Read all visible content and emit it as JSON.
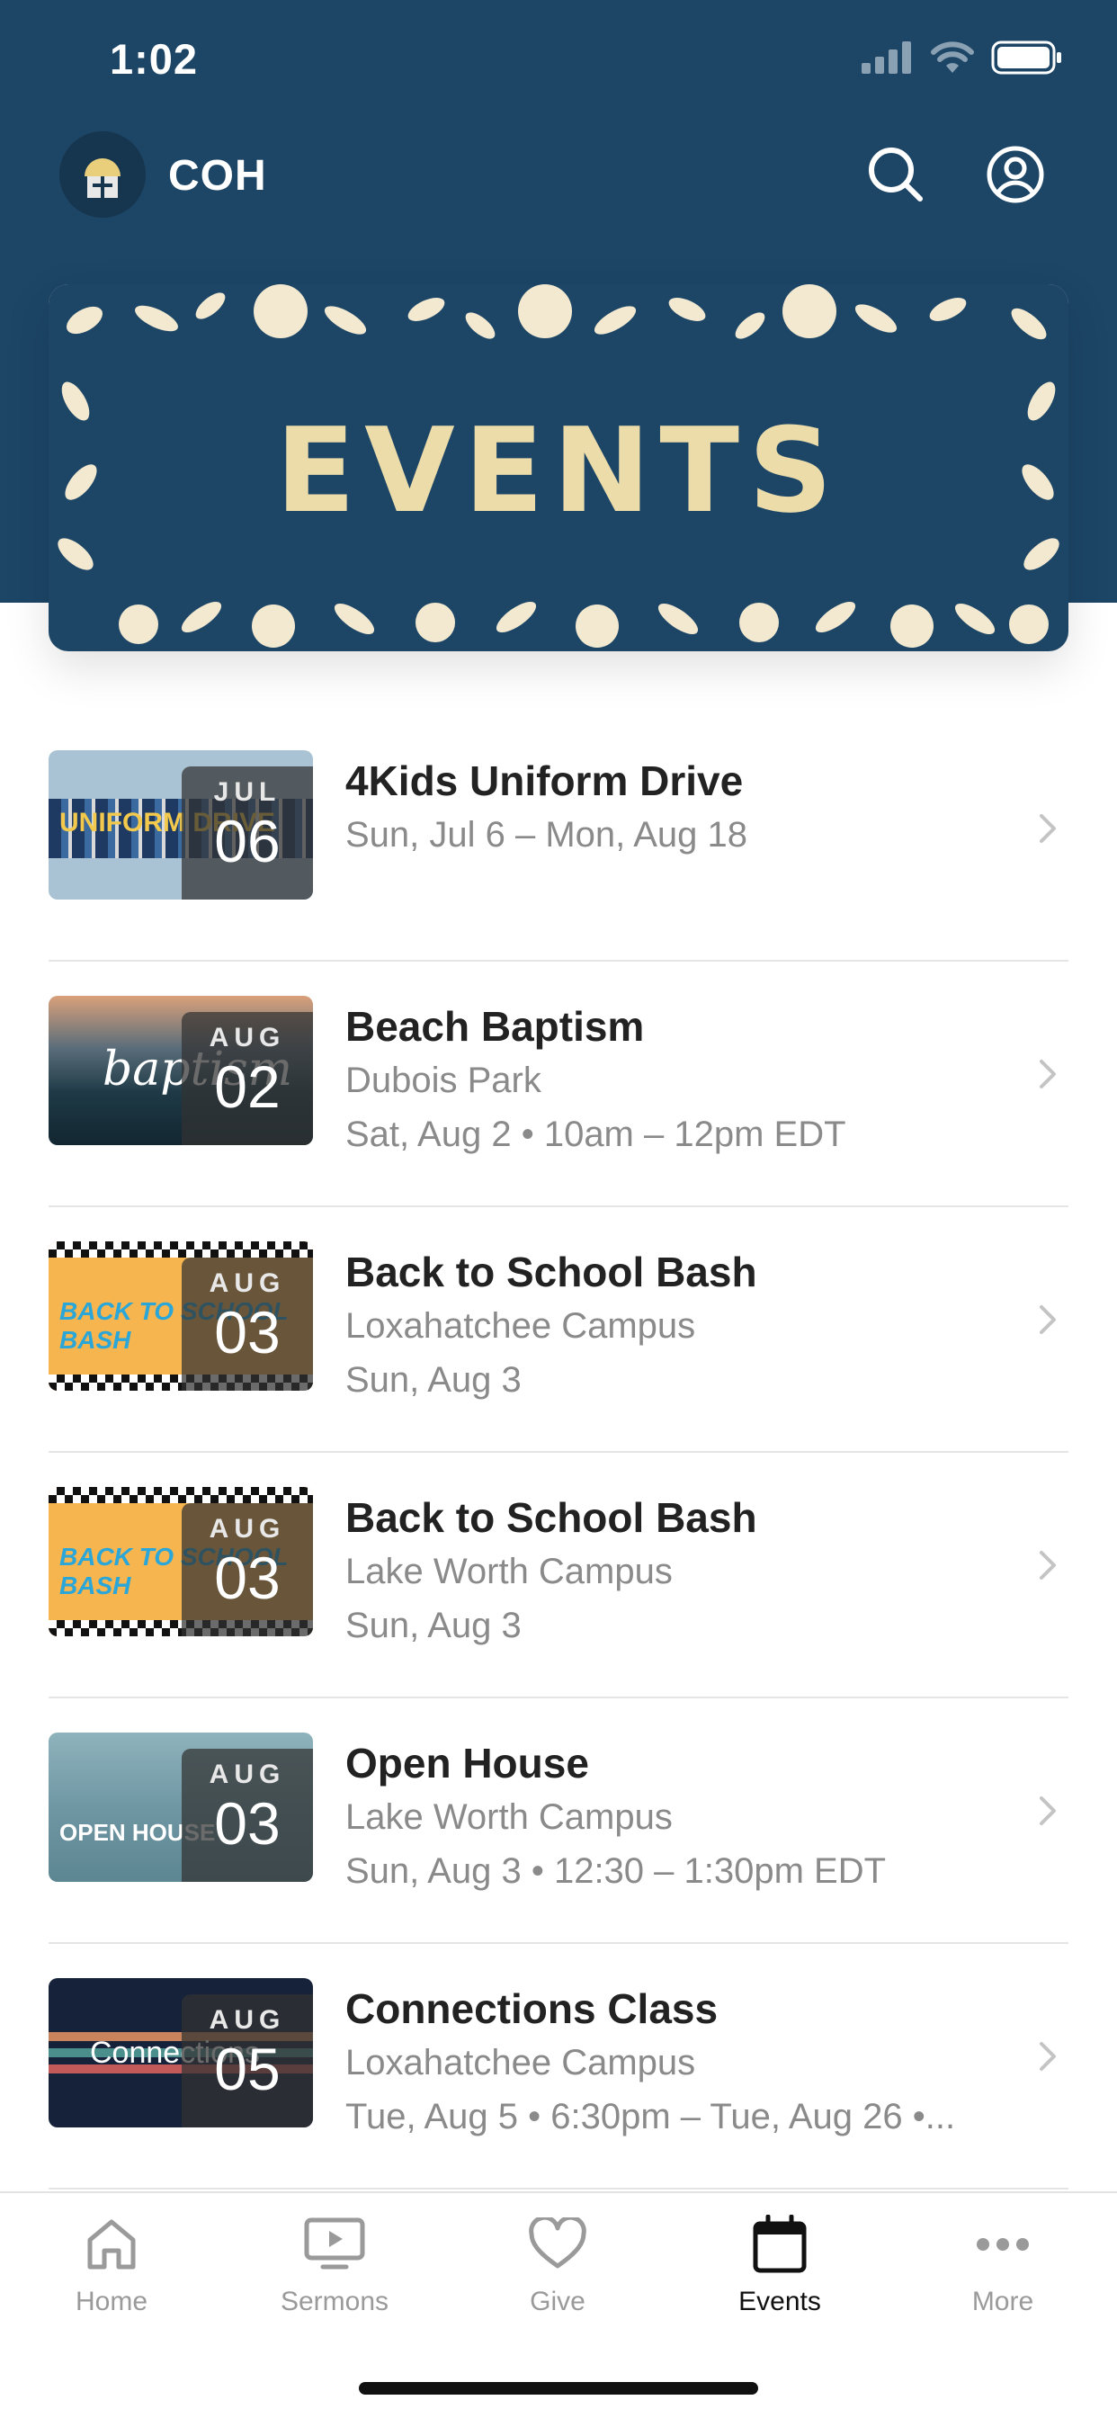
{
  "status": {
    "time": "1:02",
    "icons": [
      "signal-icon",
      "wifi-icon",
      "battery-icon"
    ]
  },
  "header": {
    "app_name": "COH",
    "logo_icon": "church-logo",
    "search_icon": "search-icon",
    "profile_icon": "profile-icon"
  },
  "banner": {
    "title": "EVENTS"
  },
  "colors": {
    "primary": "#1c4566",
    "banner_text": "#ecdcaa",
    "active_tab": "#111111",
    "inactive_tab": "#9a9a9a"
  },
  "events": [
    {
      "title": "4Kids Uniform Drive",
      "month": "JUL",
      "day": "06",
      "line1": "Sun, Jul 6 – Mon, Aug 18",
      "line2": "",
      "thumb_text": "UNIFORM DRIVE"
    },
    {
      "title": "Beach Baptism",
      "month": "AUG",
      "day": "02",
      "line1": "Dubois Park",
      "line2": "Sat, Aug 2 • 10am – 12pm EDT",
      "thumb_text": "baptism"
    },
    {
      "title": "Back to School Bash",
      "month": "AUG",
      "day": "03",
      "line1": "Loxahatchee Campus",
      "line2": "Sun, Aug 3",
      "thumb_text": "BACK TO SCHOOL BASH"
    },
    {
      "title": "Back to School Bash",
      "month": "AUG",
      "day": "03",
      "line1": "Lake Worth Campus",
      "line2": "Sun, Aug 3",
      "thumb_text": "BACK TO SCHOOL BASH"
    },
    {
      "title": "Open House",
      "month": "AUG",
      "day": "03",
      "line1": "Lake Worth Campus",
      "line2": "Sun, Aug 3 • 12:30 – 1:30pm EDT",
      "thumb_text": "OPEN HOUSE"
    },
    {
      "title": "Connections Class",
      "month": "AUG",
      "day": "05",
      "line1": "Loxahatchee Campus",
      "line2": "Tue, Aug 5 • 6:30pm – Tue, Aug 26 •...",
      "thumb_text": "Connections"
    }
  ],
  "tabs": [
    {
      "label": "Home",
      "icon": "home-icon"
    },
    {
      "label": "Sermons",
      "icon": "tv-icon"
    },
    {
      "label": "Give",
      "icon": "heart-icon"
    },
    {
      "label": "Events",
      "icon": "calendar-icon",
      "active": true
    },
    {
      "label": "More",
      "icon": "more-icon"
    }
  ]
}
